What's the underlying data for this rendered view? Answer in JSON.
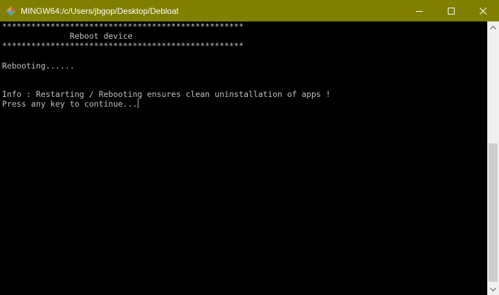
{
  "window": {
    "title": "MINGW64:/c/Users/jbgop/Desktop/Debloat",
    "titlebar_color": "#807f00",
    "icons": {
      "app": "mingw-diamond-icon",
      "minimize": "minimize-icon",
      "maximize": "maximize-icon",
      "close": "close-icon"
    }
  },
  "terminal": {
    "background": "#000000",
    "foreground": "#c0c0c0",
    "lines": [
      "**************************************************",
      "              Reboot device",
      "**************************************************",
      "",
      "Rebooting......",
      "",
      "",
      "Info : Restarting / Rebooting ensures clean uninstallation of apps !",
      "Press any key to continue..."
    ]
  },
  "scrollbar": {
    "position_fraction": 1.0
  }
}
